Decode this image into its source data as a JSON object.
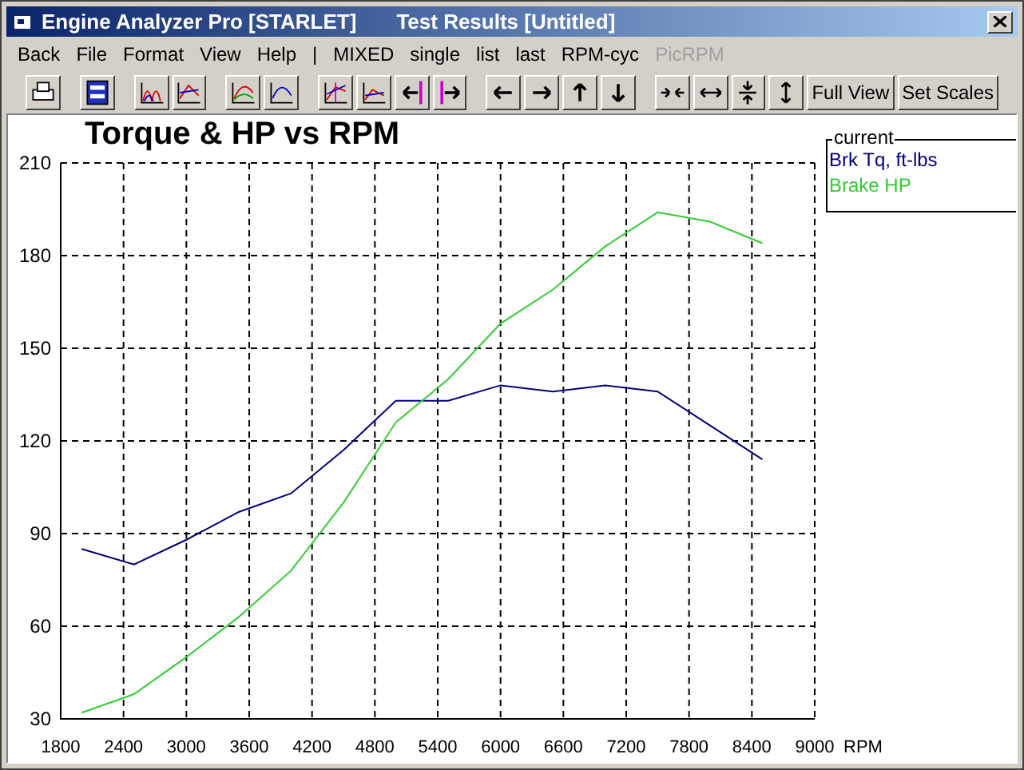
{
  "window": {
    "title": "Engine Analyzer Pro [STARLET]",
    "document": "Test Results [Untitled]"
  },
  "menu": [
    {
      "label": "Back",
      "disabled": false
    },
    {
      "label": "File",
      "disabled": false
    },
    {
      "label": "Format",
      "disabled": false
    },
    {
      "label": "View",
      "disabled": false
    },
    {
      "label": "Help",
      "disabled": false
    },
    {
      "label": "|",
      "disabled": false
    },
    {
      "label": "MIXED",
      "disabled": false
    },
    {
      "label": "single",
      "disabled": false
    },
    {
      "label": "list",
      "disabled": false
    },
    {
      "label": "last",
      "disabled": false
    },
    {
      "label": "RPM-cyc",
      "disabled": false
    },
    {
      "label": "PicRPM",
      "disabled": true
    }
  ],
  "toolbar": [
    {
      "kind": "icon"
    },
    {
      "kind": "icon"
    },
    {
      "kind": "icon"
    },
    {
      "kind": "icon"
    },
    {
      "kind": "icon"
    },
    {
      "kind": "icon"
    },
    {
      "kind": "icon"
    },
    {
      "kind": "icon"
    },
    {
      "kind": "icon"
    },
    {
      "kind": "icon"
    },
    {
      "kind": "icon"
    },
    {
      "kind": "icon"
    },
    {
      "kind": "icon"
    },
    {
      "kind": "icon"
    },
    {
      "kind": "icon"
    },
    {
      "kind": "icon"
    },
    {
      "kind": "icon"
    },
    {
      "kind": "icon"
    },
    {
      "kind": "text",
      "label": "Full View"
    },
    {
      "kind": "text",
      "label": "Set Scales"
    }
  ],
  "legend": {
    "title": "current"
  },
  "chart_data": {
    "type": "line",
    "title": "Torque & HP vs RPM",
    "xlabel": "RPM",
    "x": [
      2000,
      2500,
      3000,
      3500,
      4000,
      4500,
      5000,
      5500,
      6000,
      6500,
      7000,
      7500,
      8000,
      8500
    ],
    "series": [
      {
        "name": "Brk Tq, ft-lbs",
        "color": "#000080",
        "values": [
          85,
          80,
          88,
          97,
          103,
          117,
          133,
          133,
          138,
          136,
          138,
          136,
          125,
          114
        ]
      },
      {
        "name": "Brake HP",
        "color": "#33cc33",
        "values": [
          32,
          38,
          50,
          63,
          78,
          100,
          126,
          140,
          158,
          169,
          183,
          194,
          191,
          184
        ]
      }
    ],
    "xlim": [
      1800,
      9000
    ],
    "ylim": [
      30,
      210
    ],
    "xticks": [
      1800,
      2400,
      3000,
      3600,
      4200,
      4800,
      5400,
      6000,
      6600,
      7200,
      7800,
      8400,
      9000
    ],
    "yticks": [
      30,
      60,
      90,
      120,
      150,
      180,
      210
    ],
    "grid": true
  }
}
